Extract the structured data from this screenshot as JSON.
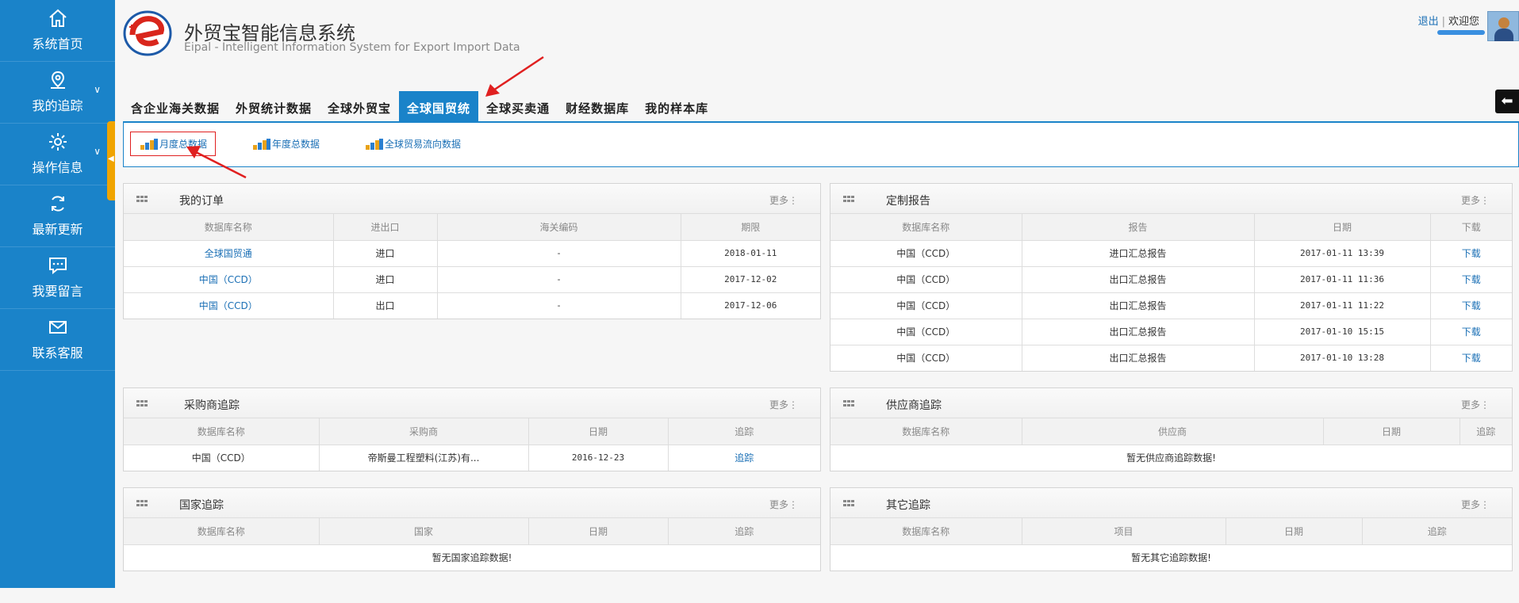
{
  "sidebar": {
    "items": [
      {
        "label": "系统首页",
        "icon": "home-icon",
        "has_chevron": false
      },
      {
        "label": "我的追踪",
        "icon": "location-pin-icon",
        "has_chevron": true
      },
      {
        "label": "操作信息",
        "icon": "gear-icon",
        "has_chevron": true
      },
      {
        "label": "最新更新",
        "icon": "refresh-icon",
        "has_chevron": false
      },
      {
        "label": "我要留言",
        "icon": "chat-icon",
        "has_chevron": false
      },
      {
        "label": "联系客服",
        "icon": "mail-icon",
        "has_chevron": false
      }
    ],
    "chevron": "∨",
    "collapse_handle": "◀"
  },
  "header": {
    "title": "外贸宝智能信息系统",
    "subtitle": "Eipal - Intelligent Information System for Export Import Data",
    "logout": "退出",
    "welcome": "欢迎您",
    "back_arrow": "⬅"
  },
  "tabs": [
    "含企业海关数据",
    "外贸统计数据",
    "全球外贸宝",
    "全球国贸统",
    "全球买卖通",
    "财经数据库",
    "我的样本库"
  ],
  "active_tab": 3,
  "subtabs": [
    "月度总数据",
    "年度总数据",
    "全球贸易流向数据"
  ],
  "more_label": "更多⋮",
  "panels": {
    "orders": {
      "title": "我的订单",
      "headers": [
        "数据库名称",
        "进出口",
        "海关编码",
        "期限"
      ],
      "rows": [
        [
          "全球国贸通",
          "进口",
          "-",
          "2018-01-11"
        ],
        [
          "中国（CCD）",
          "进口",
          "-",
          "2017-12-02"
        ],
        [
          "中国（CCD）",
          "出口",
          "-",
          "2017-12-06"
        ]
      ]
    },
    "reports": {
      "title": "定制报告",
      "headers": [
        "数据库名称",
        "报告",
        "日期",
        "下载"
      ],
      "rows": [
        [
          "中国（CCD）",
          "进口汇总报告",
          "2017-01-11 13:39",
          "下载"
        ],
        [
          "中国（CCD）",
          "出口汇总报告",
          "2017-01-11 11:36",
          "下载"
        ],
        [
          "中国（CCD）",
          "出口汇总报告",
          "2017-01-11 11:22",
          "下载"
        ],
        [
          "中国（CCD）",
          "出口汇总报告",
          "2017-01-10 15:15",
          "下载"
        ],
        [
          "中国（CCD）",
          "出口汇总报告",
          "2017-01-10 13:28",
          "下载"
        ]
      ]
    },
    "buyers": {
      "title": "采购商追踪",
      "headers": [
        "数据库名称",
        "采购商",
        "日期",
        "追踪"
      ],
      "rows": [
        [
          "中国（CCD）",
          "帝斯曼工程塑料(江苏)有...",
          "2016-12-23",
          "追踪"
        ]
      ]
    },
    "suppliers": {
      "title": "供应商追踪",
      "headers": [
        "数据库名称",
        "供应商",
        "日期",
        "追踪"
      ],
      "empty": "暂无供应商追踪数据!"
    },
    "countries": {
      "title": "国家追踪",
      "headers": [
        "数据库名称",
        "国家",
        "日期",
        "追踪"
      ],
      "empty": "暂无国家追踪数据!"
    },
    "others": {
      "title": "其它追踪",
      "headers": [
        "数据库名称",
        "项目",
        "日期",
        "追踪"
      ],
      "empty": "暂无其它追踪数据!"
    }
  },
  "colors": {
    "brand_blue": "#1a83c9",
    "link_blue": "#1a6fb5",
    "handle_orange": "#f0a400",
    "annotation_red": "#e02020"
  }
}
